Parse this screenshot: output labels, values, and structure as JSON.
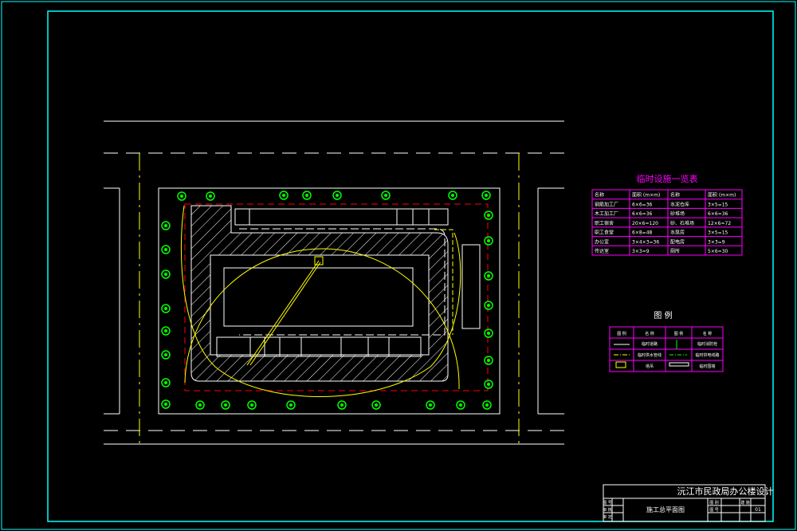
{
  "drawing": {
    "title_block": {
      "project": "沅江市民政局办公楼设计",
      "sheet_name": "施工总平面图",
      "sheet_no": "01",
      "row_labels": [
        "图 号",
        "审 核",
        "审 定"
      ],
      "col_labels": [
        "图 别",
        "图 号",
        "建 施"
      ]
    },
    "facility_table": {
      "title": "临时设施一览表",
      "headers": [
        "名称",
        "面积 (m×m)",
        "名称",
        "面积 (m×m)"
      ],
      "rows": [
        [
          "钢筋加工厂",
          "6×6=36",
          "水泥仓库",
          "3×5=15"
        ],
        [
          "木工加工厂",
          "6×6=36",
          "砂堆场",
          "6×6=36"
        ],
        [
          "职工宿舍",
          "20×6=120",
          "砂、石堆场",
          "12×6=72"
        ],
        [
          "职工食堂",
          "6×8=48",
          "水泵房",
          "3×5=15"
        ],
        [
          "办公室",
          "3×4×3=36",
          "配电房",
          "3×3=9"
        ],
        [
          "传达室",
          "3×3=9",
          "厕所",
          "5×6=30"
        ]
      ]
    },
    "legend": {
      "title": "图 例",
      "headers": [
        "图 例",
        "名 称",
        "图 例",
        "名 称"
      ],
      "items": [
        [
          "临时道路",
          "临时消防栓"
        ],
        [
          "临时供水管线",
          "临时供电线路"
        ],
        [
          "塔吊",
          "临时围墙"
        ]
      ]
    },
    "colors": {
      "frame": "#00ffff",
      "site": "#ffffff",
      "axis": "#ffff00",
      "fence": "#ff0000",
      "tree": "#00ff00",
      "table": "#ff00ff",
      "text": "#ffffff"
    }
  }
}
